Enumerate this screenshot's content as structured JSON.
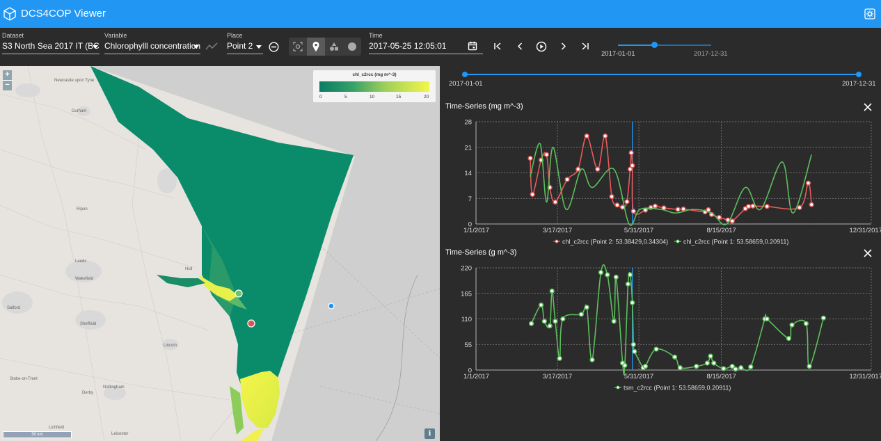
{
  "app": {
    "title": "DCS4COP Viewer"
  },
  "toolbar": {
    "dataset_label": "Dataset",
    "dataset_value": "S3 North Sea 2017 IT (BC)",
    "variable_label": "Variable",
    "variable_value": "Chlorophylll concentration",
    "place_label": "Place",
    "place_value": "Point 2",
    "time_label": "Time",
    "time_value": "2017-05-25 12:05:01",
    "slider_start": "2017-01-01",
    "slider_end": "2017-12-31"
  },
  "map": {
    "colorbar_title": "chl_c2rcc (mg m^-3)",
    "colorbar_ticks": [
      "0",
      "5",
      "10",
      "15",
      "20"
    ],
    "scale_label": "50 km",
    "places": [
      "Newcastle upon Tyne",
      "Durham",
      "Ripon",
      "Leeds",
      "Wakefield",
      "Hull",
      "Salford",
      "Sheffield",
      "Lincoln",
      "Stoke-on-Trent",
      "Nottingham",
      "Derby",
      "Leicester",
      "Lichfield"
    ],
    "colors": {
      "water_low": "#0a8c6a",
      "water_high": "#f3f64a",
      "land": "#e7e4df"
    }
  },
  "panel": {
    "range_start": "2017-01-01",
    "range_end": "2017-12-31"
  },
  "colors": {
    "accent": "#2196f3",
    "series_red": "#e85a5a",
    "series_green": "#5cbf5c"
  },
  "chart_data": [
    {
      "type": "line",
      "title": "Time-Series (mg m^-3)",
      "x_ticks": [
        "1/1/2017",
        "3/17/2017",
        "5/31/2017",
        "8/15/2017",
        "12/31/2017"
      ],
      "y_ticks": [
        "0",
        "7",
        "14",
        "21",
        "28"
      ],
      "ylim": [
        0,
        28
      ],
      "xlim": [
        "2017-01-01",
        "2017-12-31"
      ],
      "current_time": "2017-05-25",
      "grid": true,
      "legend": "bottom",
      "series": [
        {
          "name": "chl_c2rcc (Point 2: 53.38429,0.34304)",
          "color": "#e85a5a",
          "x": [
            "2017-02-20",
            "2017-02-22",
            "2017-03-02",
            "2017-03-07",
            "2017-03-10",
            "2017-03-15",
            "2017-03-26",
            "2017-04-05",
            "2017-04-13",
            "2017-04-23",
            "2017-04-30",
            "2017-05-06",
            "2017-05-11",
            "2017-05-16",
            "2017-05-20",
            "2017-05-23",
            "2017-05-24",
            "2017-05-25",
            "2017-05-26",
            "2017-06-06",
            "2017-06-11",
            "2017-06-15",
            "2017-06-23",
            "2017-07-06",
            "2017-07-11",
            "2017-07-31",
            "2017-08-03",
            "2017-08-06",
            "2017-08-13",
            "2017-08-21",
            "2017-08-25",
            "2017-09-06",
            "2017-09-09",
            "2017-09-13",
            "2017-09-26",
            "2017-10-26",
            "2017-11-03",
            "2017-11-06"
          ],
          "y": [
            18.0,
            8.1,
            17.5,
            19.0,
            10.0,
            6.0,
            12.2,
            15.0,
            24.1,
            15.0,
            24.1,
            7.5,
            5.2,
            4.6,
            6.1,
            15.0,
            19.5,
            16.0,
            3.5,
            3.8,
            4.5,
            4.9,
            4.4,
            4.0,
            4.1,
            3.3,
            3.9,
            2.6,
            1.8,
            1.1,
            0.8,
            4.2,
            4.8,
            4.9,
            4.8,
            4.5,
            11.2,
            5.3
          ]
        },
        {
          "name": "chl_c2rcc (Point 1: 53.58659,0.20911)",
          "color": "#5cbf5c",
          "x": [
            "2017-02-20",
            "2017-03-01",
            "2017-03-07",
            "2017-03-13",
            "2017-03-25",
            "2017-04-08",
            "2017-04-18",
            "2017-05-08",
            "2017-05-22",
            "2017-06-01",
            "2017-06-20",
            "2017-07-04",
            "2017-07-20",
            "2017-08-06",
            "2017-08-20",
            "2017-09-06",
            "2017-09-20",
            "2017-10-10",
            "2017-10-20",
            "2017-11-06"
          ],
          "y": [
            13,
            22,
            6,
            21,
            4,
            15,
            10,
            15,
            0,
            4,
            4,
            3,
            4,
            3,
            0,
            10,
            4,
            17,
            3,
            19
          ]
        }
      ]
    },
    {
      "type": "line",
      "title": "Time-Series (g m^-3)",
      "x_ticks": [
        "1/1/2017",
        "3/17/2017",
        "5/31/2017",
        "8/15/2017",
        "12/31/2017"
      ],
      "y_ticks": [
        "0",
        "55",
        "110",
        "165",
        "220"
      ],
      "ylim": [
        0,
        220
      ],
      "xlim": [
        "2017-01-01",
        "2017-12-31"
      ],
      "current_time": "2017-05-25",
      "grid": true,
      "legend": "bottom",
      "series": [
        {
          "name": "tsm_c2rcc (Point 1: 53.58659,0.20911)",
          "color": "#5cbf5c",
          "x": [
            "2017-02-21",
            "2017-03-02",
            "2017-03-05",
            "2017-03-10",
            "2017-03-12",
            "2017-03-15",
            "2017-03-19",
            "2017-03-22",
            "2017-04-08",
            "2017-04-13",
            "2017-04-18",
            "2017-04-26",
            "2017-05-02",
            "2017-05-08",
            "2017-05-10",
            "2017-05-16",
            "2017-05-18",
            "2017-05-21",
            "2017-05-23",
            "2017-05-25",
            "2017-05-26",
            "2017-05-27",
            "2017-06-04",
            "2017-06-06",
            "2017-06-16",
            "2017-07-03",
            "2017-07-08",
            "2017-07-23",
            "2017-08-02",
            "2017-08-05",
            "2017-08-08",
            "2017-08-17",
            "2017-08-25",
            "2017-08-28",
            "2017-09-02",
            "2017-09-11",
            "2017-09-24",
            "2017-09-26",
            "2017-10-16",
            "2017-10-19",
            "2017-11-01",
            "2017-11-04",
            "2017-11-17"
          ],
          "y": [
            100,
            140,
            105,
            95,
            170,
            105,
            25,
            110,
            120,
            135,
            22,
            210,
            205,
            105,
            200,
            15,
            10,
            185,
            205,
            145,
            55,
            40,
            5,
            8,
            45,
            28,
            5,
            8,
            15,
            30,
            15,
            3,
            8,
            2,
            5,
            7,
            110,
            110,
            68,
            97,
            100,
            8,
            112
          ]
        }
      ]
    }
  ]
}
